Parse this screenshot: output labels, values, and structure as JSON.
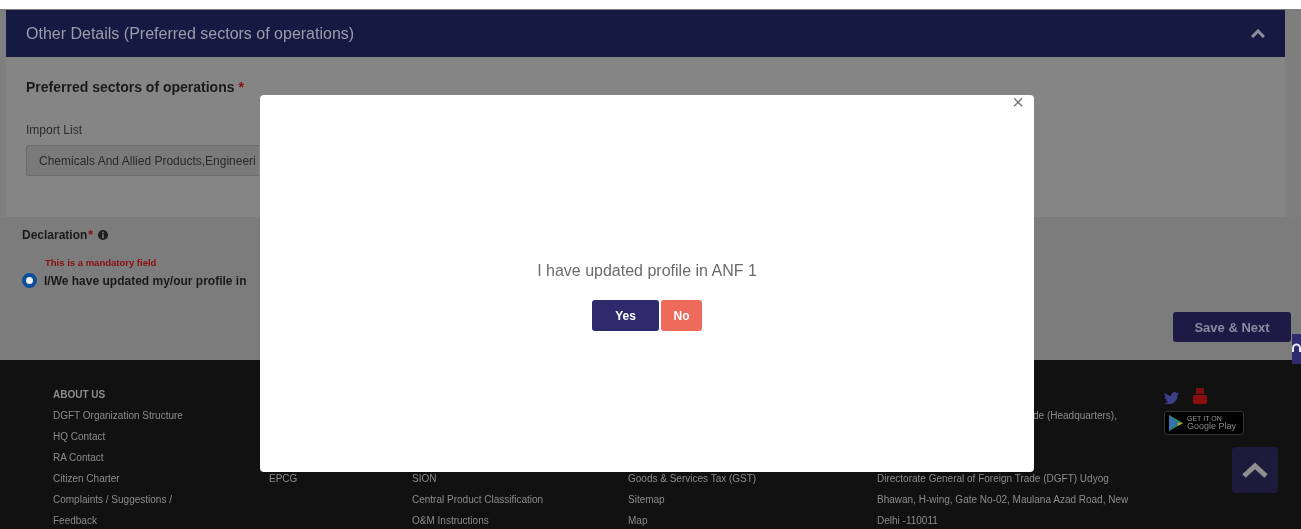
{
  "section": {
    "title": "Other Details (Preferred sectors of operations)",
    "expanded": true
  },
  "form": {
    "heading": "Preferred sectors of operations",
    "required_mark": "*",
    "import_label": "Import List",
    "import_value": "Chemicals And Allied Products,Engineeri"
  },
  "declaration": {
    "label": "Declaration",
    "required_mark": "*",
    "error": "This is a mandatory field",
    "option": {
      "label": "I/We have updated my/our profile in",
      "selected": true
    }
  },
  "save_button": "Save & Next",
  "footer": {
    "columns": [
      [
        "ABOUT US",
        "DGFT Organization Structure",
        "HQ Contact",
        "RA Contact",
        "Citizen Charter",
        "Complaints / Suggestions /",
        "Feedback"
      ],
      [
        "EPCG"
      ],
      [
        "SION",
        "Central Product Classification",
        "O&M Instructions"
      ],
      [
        "Goods & Services Tax (GST)",
        "Sitemap",
        "Map"
      ],
      [
        "de (Headquarters),",
        "Directorate General of Foreign Trade (DGFT) Udyog",
        "Bhawan, H-wing, Gate No-02, Maulana Azad Road, New",
        "Delhi -110011"
      ]
    ],
    "badge": {
      "small": "GET IT ON",
      "large": "Google Play"
    }
  },
  "dialog": {
    "message": "I have updated profile in ANF 1",
    "close": "×",
    "buttons": [
      {
        "label": "Yes",
        "kind": "primary"
      },
      {
        "label": "No",
        "kind": "danger"
      }
    ]
  }
}
